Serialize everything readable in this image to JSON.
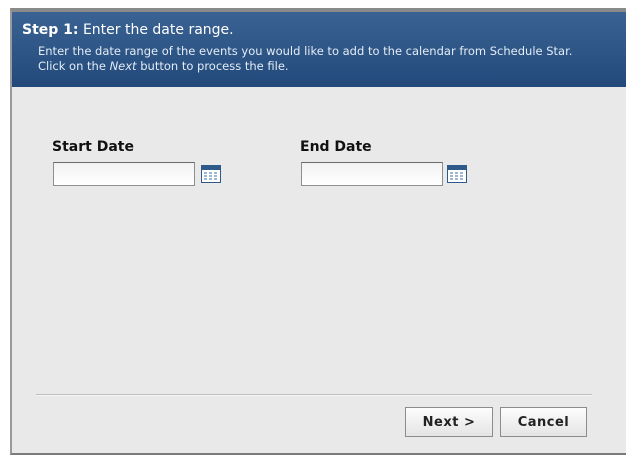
{
  "header": {
    "step_prefix": "Step 1:",
    "step_title": " Enter the date range.",
    "desc_line1": "Enter the date range of the events you would like to add to the calendar from Schedule Star.",
    "desc_line2_pre": "Click on the ",
    "desc_line2_em": "Next",
    "desc_line2_post": " button to process the file."
  },
  "start_date": {
    "label": "Start Date",
    "value": "",
    "icon": "calendar-icon"
  },
  "end_date": {
    "label": "End Date",
    "value": "",
    "icon": "calendar-icon"
  },
  "buttons": {
    "next_label": "Next >",
    "cancel_label": "Cancel"
  },
  "colors": {
    "header_bg": "#2b5283",
    "panel_bg": "#e9e9e9",
    "icon_accent": "#2d5a8a"
  }
}
